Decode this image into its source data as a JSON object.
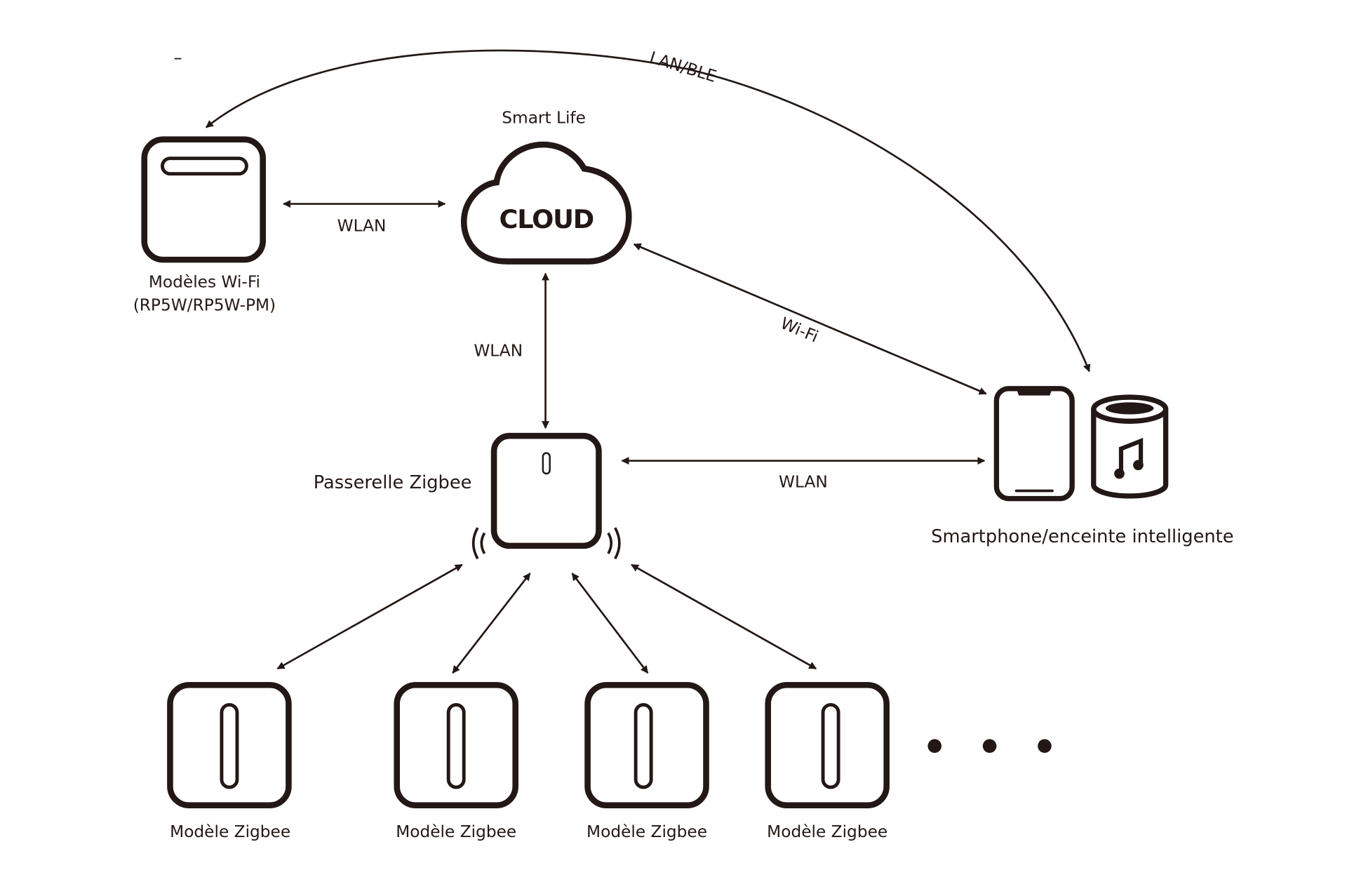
{
  "colors": {
    "ink": "#231815",
    "background": "#ffffff"
  },
  "nodes": {
    "wifi_models": {
      "label_line1": "Modèles Wi-Fi",
      "label_line2": "(RP5W/RP5W-PM)"
    },
    "cloud": {
      "title": "Smart Life",
      "text": "CLOUD"
    },
    "gateway": {
      "label": "Passerelle Zigbee"
    },
    "smartphone_speaker": {
      "label": "Smartphone/enceinte intelligente"
    },
    "zigbee_models": [
      {
        "label": "Modèle Zigbee"
      },
      {
        "label": "Modèle Zigbee"
      },
      {
        "label": "Modèle Zigbee"
      },
      {
        "label": "Modèle Zigbee"
      }
    ]
  },
  "links": {
    "lan_ble": "LAN/BLE",
    "wifi_cloud": "WLAN",
    "cloud_gateway": "WLAN",
    "cloud_phone": "Wi-Fi",
    "gateway_phone": "WLAN"
  }
}
